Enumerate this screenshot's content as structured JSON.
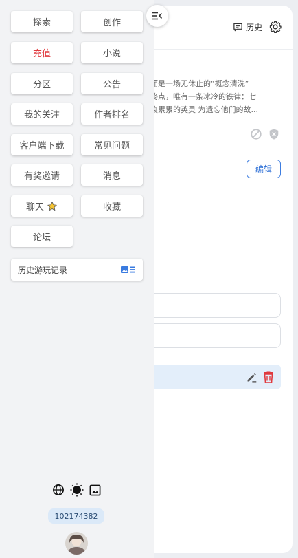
{
  "header": {
    "history_label": "历史"
  },
  "story": {
    "excerpt_line1": "，而是一场无休止的“概念清洗”",
    "excerpt_line2": "有终点，唯有一条冰冷的铁律：七",
    "excerpt_line3": "伤痕累累的英灵 为遗忘他们的故..."
  },
  "edit_label": "编辑",
  "menu": {
    "items": [
      {
        "label": "探索"
      },
      {
        "label": "创作"
      },
      {
        "label": "充值"
      },
      {
        "label": "小说"
      },
      {
        "label": "分区"
      },
      {
        "label": "公告"
      },
      {
        "label": "我的关注"
      },
      {
        "label": "作者排名"
      },
      {
        "label": "客户端下载"
      },
      {
        "label": "常见问题"
      },
      {
        "label": "有奖邀请"
      },
      {
        "label": "消息"
      },
      {
        "label": "聊天"
      },
      {
        "label": "收藏"
      },
      {
        "label": "论坛"
      }
    ],
    "history_label": "历史游玩记录"
  },
  "user": {
    "id": "102174382"
  },
  "colors": {
    "accent": "#2d6fd6",
    "recharge": "#e0393e",
    "delete": "#e0393e"
  }
}
